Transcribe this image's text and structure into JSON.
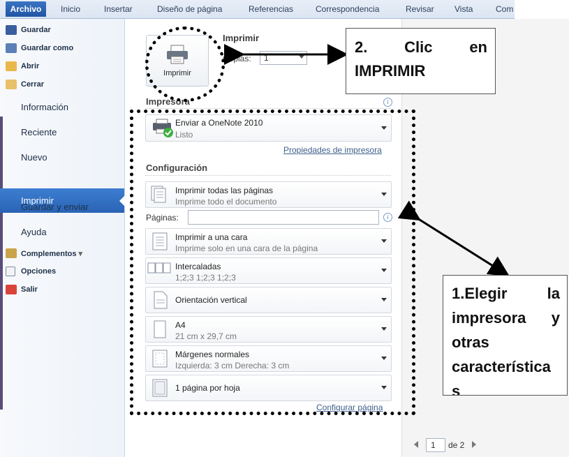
{
  "ribbon": {
    "tabs": [
      "Archivo",
      "Inicio",
      "Insertar",
      "Diseño de página",
      "Referencias",
      "Correspondencia",
      "Revisar",
      "Vista",
      "Com"
    ]
  },
  "sidebar": {
    "small_items": [
      {
        "label": "Guardar",
        "icon": "save-icon"
      },
      {
        "label": "Guardar como",
        "icon": "save-as-icon"
      },
      {
        "label": "Abrir",
        "icon": "open-folder-icon"
      },
      {
        "label": "Cerrar",
        "icon": "close-folder-icon"
      }
    ],
    "big_items": [
      "Información",
      "Reciente",
      "Nuevo",
      "Imprimir",
      "Guardar y enviar",
      "Ayuda"
    ],
    "selected": "Imprimir",
    "bottom_items": [
      {
        "label": "Complementos",
        "icon": "addins-icon",
        "dropdown": "▾"
      },
      {
        "label": "Opciones",
        "icon": "options-icon"
      },
      {
        "label": "Salir",
        "icon": "exit-icon"
      }
    ]
  },
  "print": {
    "title": "Imprimir",
    "button_label": "Imprimir",
    "copies_label": "Copias:",
    "copies_value": "1"
  },
  "printer": {
    "section_title": "Impresora",
    "name": "Enviar a OneNote 2010",
    "status": "Listo",
    "properties_link": "Propiedades de impresora"
  },
  "config": {
    "section_title": "Configuración",
    "pages_label": "Páginas:",
    "options": [
      {
        "title": "Imprimir todas las páginas",
        "subtitle": "Imprime todo el documento"
      },
      {
        "title": "Imprimir a una cara",
        "subtitle": "Imprime solo en una cara de la página"
      },
      {
        "title": "Intercaladas",
        "subtitle": "1;2;3    1;2;3    1;2;3"
      },
      {
        "title": "Orientación vertical",
        "subtitle": ""
      },
      {
        "title": "A4",
        "subtitle": "21 cm x 29,7 cm"
      },
      {
        "title": "Márgenes normales",
        "subtitle": "Izquierda:  3 cm    Derecha:  3 cm"
      },
      {
        "title": "1 página por hoja",
        "subtitle": ""
      }
    ],
    "page_setup_link": "Configurar página"
  },
  "preview_nav": {
    "page_value": "1",
    "of_label": "de 2"
  },
  "annotations": {
    "callout_2": "2.     Clic      en IMPRIMIR",
    "callout_1": "1.Elegir la impresora y otras característica s"
  },
  "colors": {
    "accent": "#2a63b5",
    "ribbon_bg": "#dbe5f2",
    "annotation": "#000000"
  }
}
